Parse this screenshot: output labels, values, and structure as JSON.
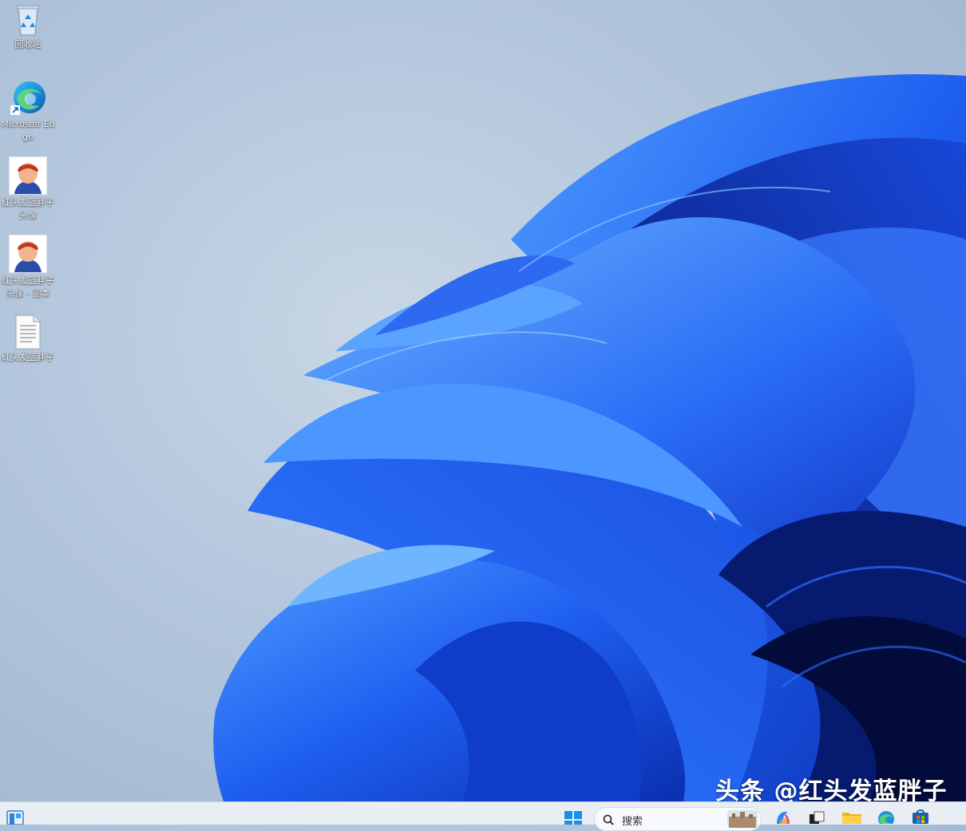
{
  "desktop": {
    "icons": [
      {
        "label": "回收站",
        "icon": "recycle-bin-icon"
      },
      {
        "label": "Microsoft Edge",
        "icon": "edge-icon"
      },
      {
        "label": "红头发蓝胖子头像",
        "icon": "avatar-image-icon"
      },
      {
        "label": "红头发蓝胖子头像 - 副本",
        "icon": "avatar-image-icon"
      },
      {
        "label": "红头发蓝胖子",
        "icon": "text-document-icon"
      }
    ]
  },
  "watermark": {
    "text": "头条 @红头发蓝胖子"
  },
  "taskbar": {
    "widgets_icon": "widgets-icon",
    "start_icon": "windows-start-icon",
    "search": {
      "placeholder": "搜索"
    },
    "pinned": [
      "copilot-icon",
      "task-view-icon",
      "file-explorer-icon",
      "edge-icon",
      "store-icon"
    ]
  },
  "colors": {
    "wallpaper_blue": "#1f55e8",
    "wallpaper_bg": "#b3c6dc",
    "taskbar_bg": "#e9eef5",
    "accent": "#0078d4"
  }
}
